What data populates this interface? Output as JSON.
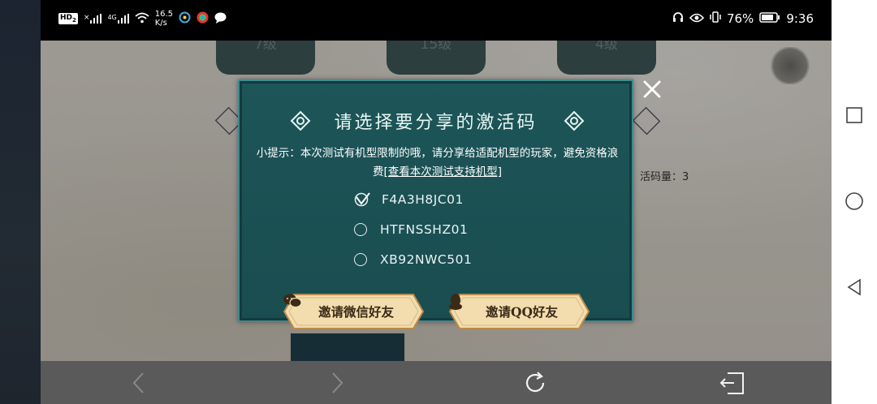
{
  "status_bar": {
    "hd_badge": "HD",
    "hd_sub": "2",
    "signal1_label": "×",
    "signal2_label": "4G",
    "net_speed_value": "16.5",
    "net_speed_unit": "K/s",
    "battery_percent": "76%",
    "time": "9:36"
  },
  "game_bg": {
    "level_tabs": [
      "7级",
      "15级",
      "4级"
    ],
    "remaining_count": "活码量：3"
  },
  "modal": {
    "title": "请选择要分享的激活码",
    "tip": "小提示：本次测试有机型限制的哦，请分享给适配机型的玩家，避免资格浪费",
    "tip_link": "[查看本次测试支持机型]",
    "codes": [
      {
        "code": "F4A3H8JC01",
        "selected": true
      },
      {
        "code": "HTFNSSHZ01",
        "selected": false
      },
      {
        "code": "XB92NWC501",
        "selected": false
      }
    ],
    "wechat_button": "邀请微信好友",
    "qq_button": "邀请QQ好友"
  },
  "colors": {
    "modal_bg": "#1d5558",
    "modal_border": "#3f8a8e",
    "button_gold": "#f3dcae"
  }
}
